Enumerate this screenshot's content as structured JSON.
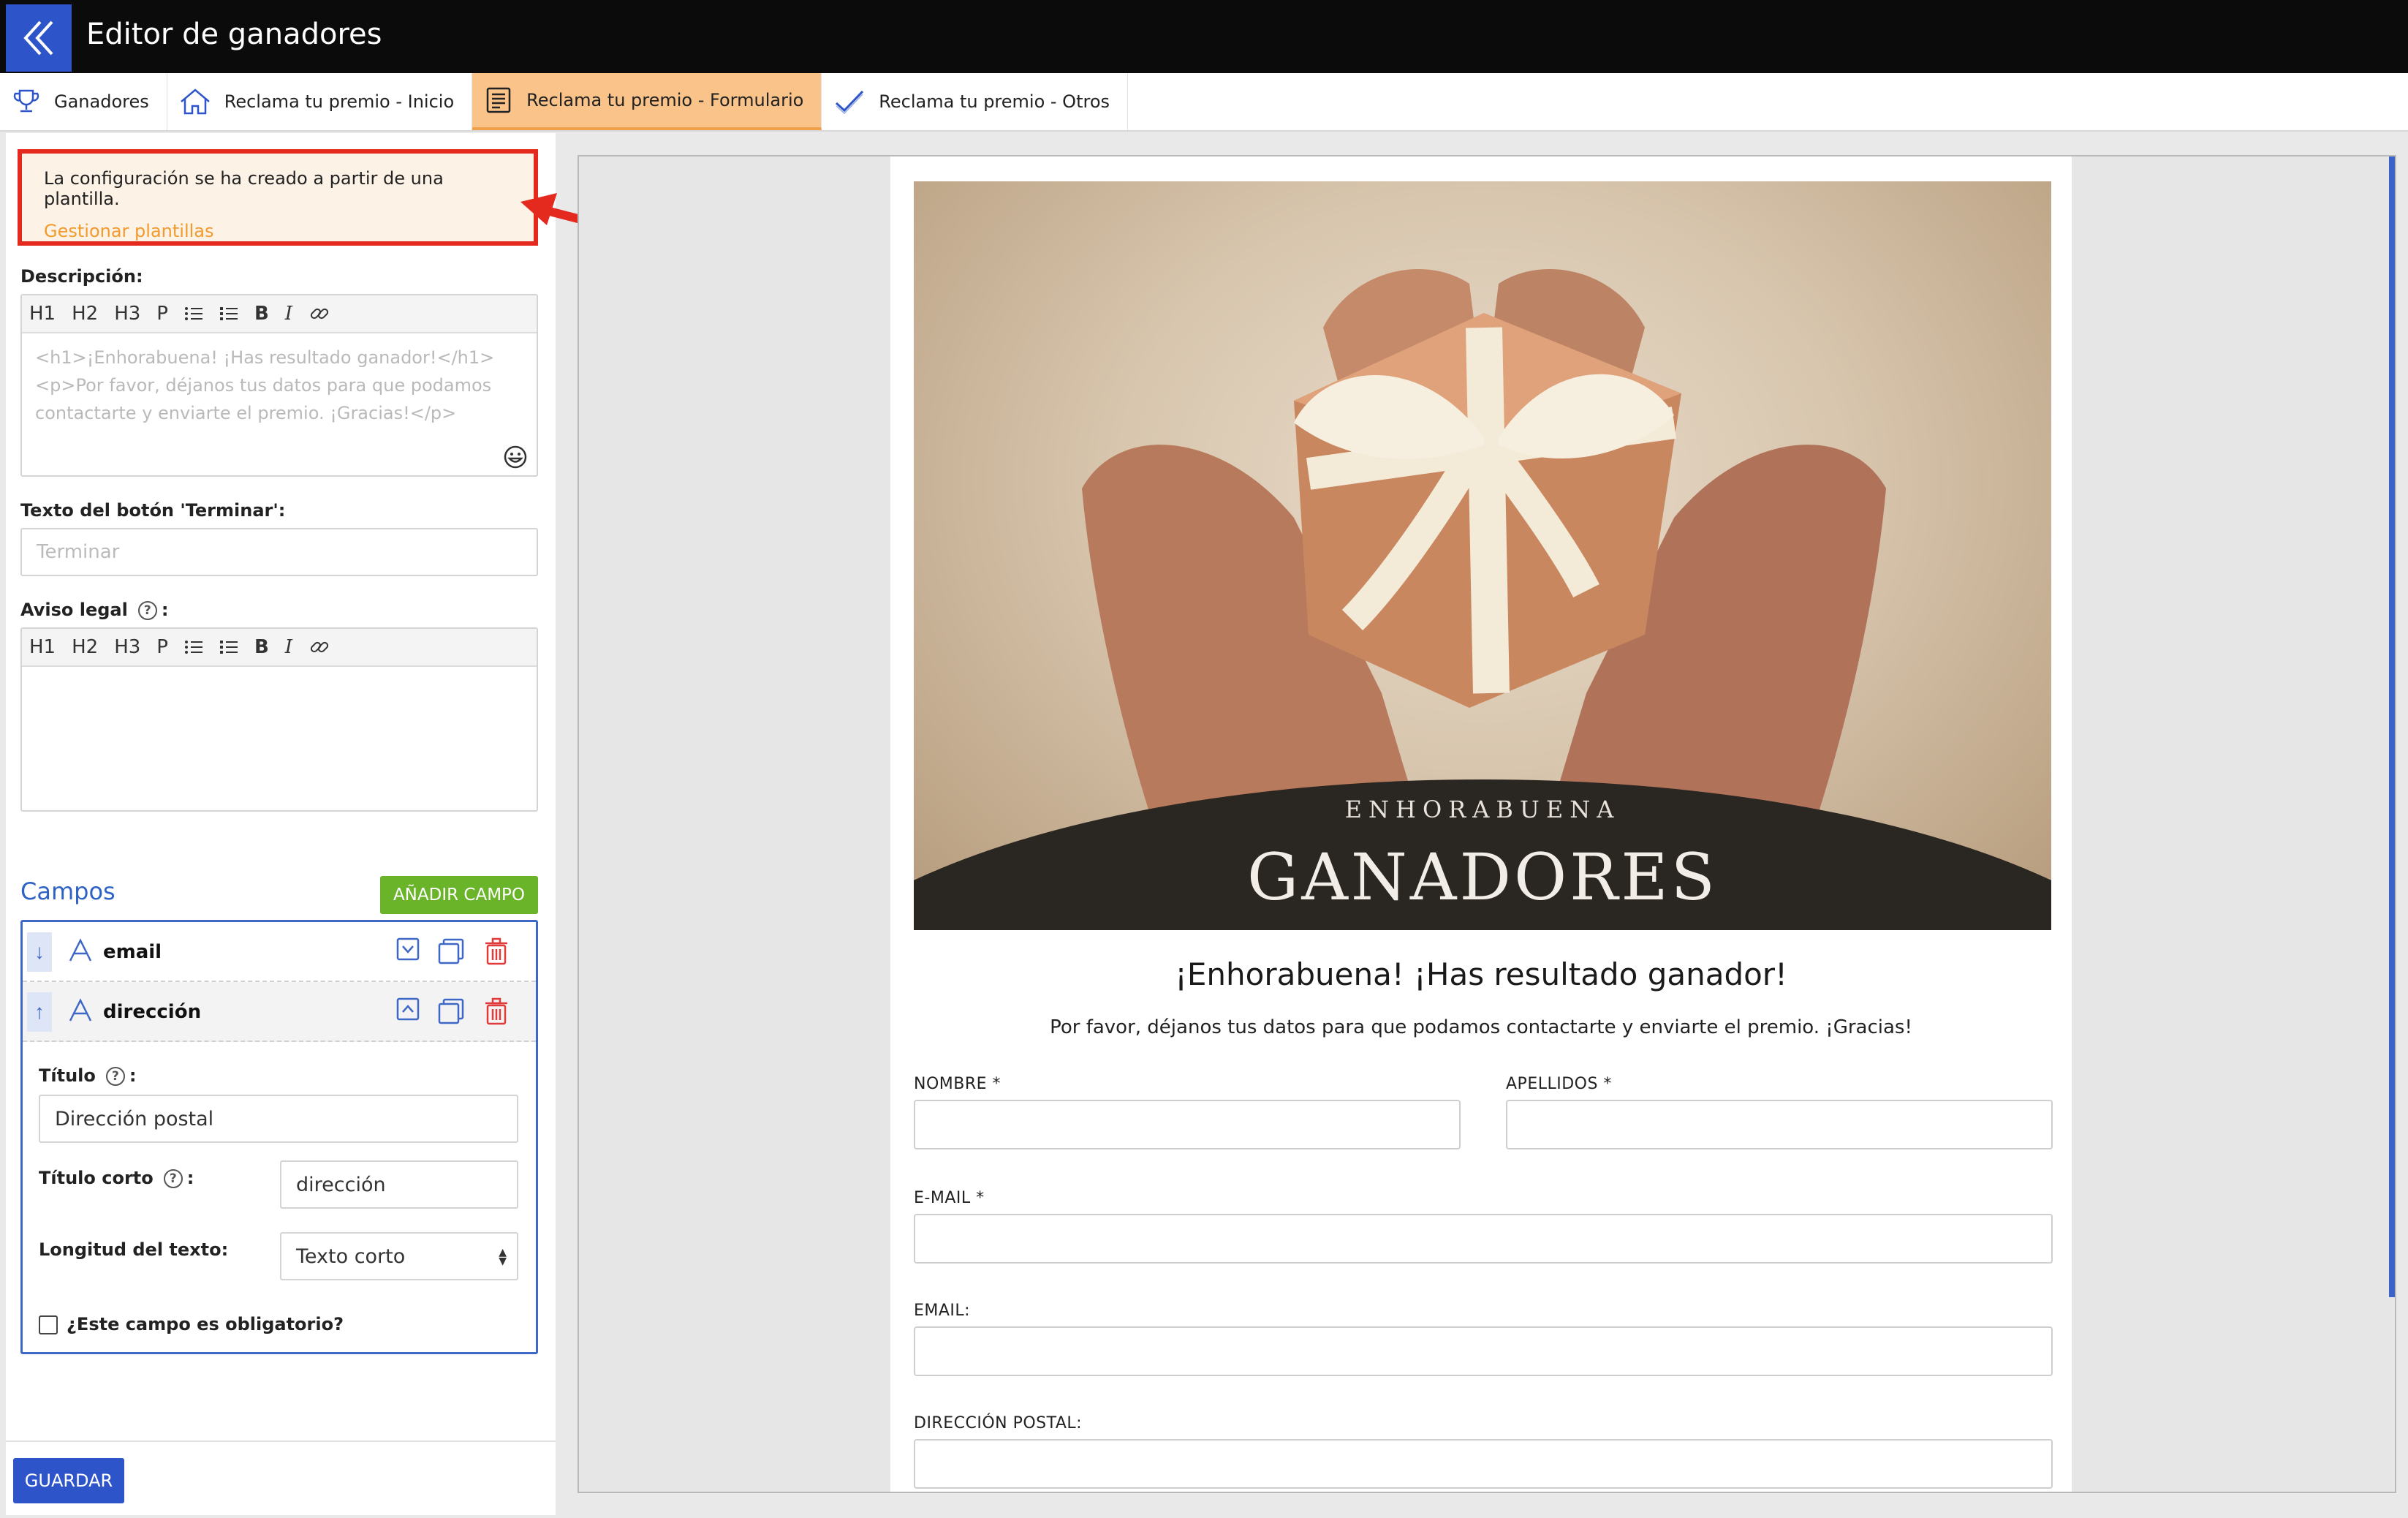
{
  "app": {
    "title": "Editor de ganadores"
  },
  "tabs": [
    {
      "label": "Ganadores",
      "icon": "trophy-icon"
    },
    {
      "label": "Reclama tu premio - Inicio",
      "icon": "home-icon"
    },
    {
      "label": "Reclama tu premio - Formulario",
      "icon": "form-icon",
      "active": true
    },
    {
      "label": "Reclama tu premio - Otros",
      "icon": "check-icon"
    }
  ],
  "notice": {
    "message": "La configuración se ha creado a partir de una plantilla.",
    "link": "Gestionar plantillas"
  },
  "descripcion": {
    "label": "Descripción:",
    "toolbar": [
      "H1",
      "H2",
      "H3",
      "P"
    ],
    "content_line1": "<h1>¡Enhorabuena! ¡Has resultado ganador!</h1>",
    "content_line2": "<p>Por favor, déjanos tus datos para que podamos",
    "content_line3": "contactarte y enviarte el premio. ¡Gracias!</p>"
  },
  "terminar": {
    "label": "Texto del botón 'Terminar':",
    "placeholder": "Terminar"
  },
  "aviso": {
    "label": "Aviso legal",
    "suffix": ":"
  },
  "campos": {
    "title": "Campos",
    "add_button": "AÑADIR CAMPO",
    "fields": [
      {
        "name": "email"
      },
      {
        "name": "dirección"
      }
    ],
    "detail": {
      "titulo_label": "Título",
      "titulo_value": "Dirección postal",
      "titulo_corto_label": "Título corto",
      "titulo_corto_value": "dirección",
      "longitud_label": "Longitud del texto:",
      "longitud_value": "Texto corto",
      "obligatorio_label": "¿Este campo es obligatorio?",
      "obligatorio_checked": false
    }
  },
  "save_button": "GUARDAR",
  "preview": {
    "hero_eyebrow": "ENHORABUENA",
    "hero_title": "GANADORES",
    "heading": "¡Enhorabuena! ¡Has resultado ganador!",
    "subheading": "Por favor, déjanos tus datos para que podamos contactarte y enviarte el premio. ¡Gracias!",
    "fields": {
      "nombre": "NOMBRE *",
      "apellidos": "APELLIDOS *",
      "email_req": "E-MAIL *",
      "email": "EMAIL:",
      "direccion": "DIRECCIÓN POSTAL:"
    }
  },
  "colors": {
    "accent_blue": "#2e54c9",
    "active_tab": "#f9c38a",
    "notice_border": "#e42a1f",
    "add_green": "#6ab42a",
    "link_orange": "#f29a2e"
  }
}
